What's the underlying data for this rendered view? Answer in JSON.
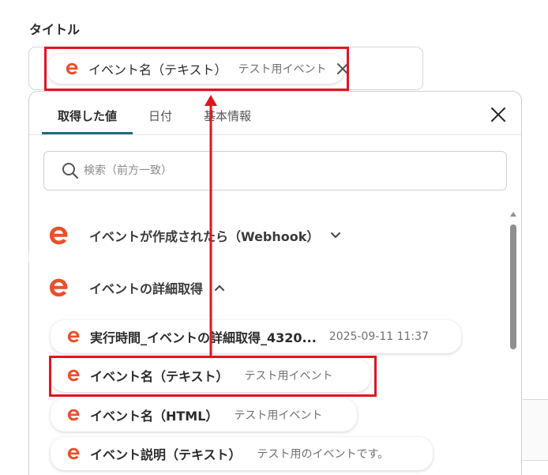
{
  "field": {
    "label": "タイトル"
  },
  "selected": {
    "label": "イベント名（テキスト）",
    "value": "テスト用イベント"
  },
  "panel": {
    "tabs": [
      {
        "label": "取得した値"
      },
      {
        "label": "日付"
      },
      {
        "label": "基本情報"
      }
    ],
    "active_tab": 0,
    "search": {
      "placeholder": "検索（前方一致）",
      "value": ""
    },
    "groups": [
      {
        "label": "イベントが作成されたら（Webhook）",
        "expanded": false
      },
      {
        "label": "イベントの詳細取得",
        "expanded": true
      }
    ],
    "items": [
      {
        "label": "実行時間_イベントの詳細取得_4320...",
        "value": "2025-09-11 11:37"
      },
      {
        "label": "イベント名（テキスト）",
        "value": "テスト用イベント"
      },
      {
        "label": "イベント名（HTML）",
        "value": "テスト用イベント"
      },
      {
        "label": "イベント説明（テキスト）",
        "value": "テスト用のイベントです。"
      }
    ]
  },
  "colors": {
    "brand": "#e8502a",
    "highlight": "#e0161e",
    "tab_underline": "#1f6d7a"
  },
  "icons": {
    "service": "eventbrite-e-icon",
    "close": "close-icon",
    "search": "search-icon",
    "expand": "chevron-down-icon",
    "collapse": "chevron-up-icon"
  }
}
